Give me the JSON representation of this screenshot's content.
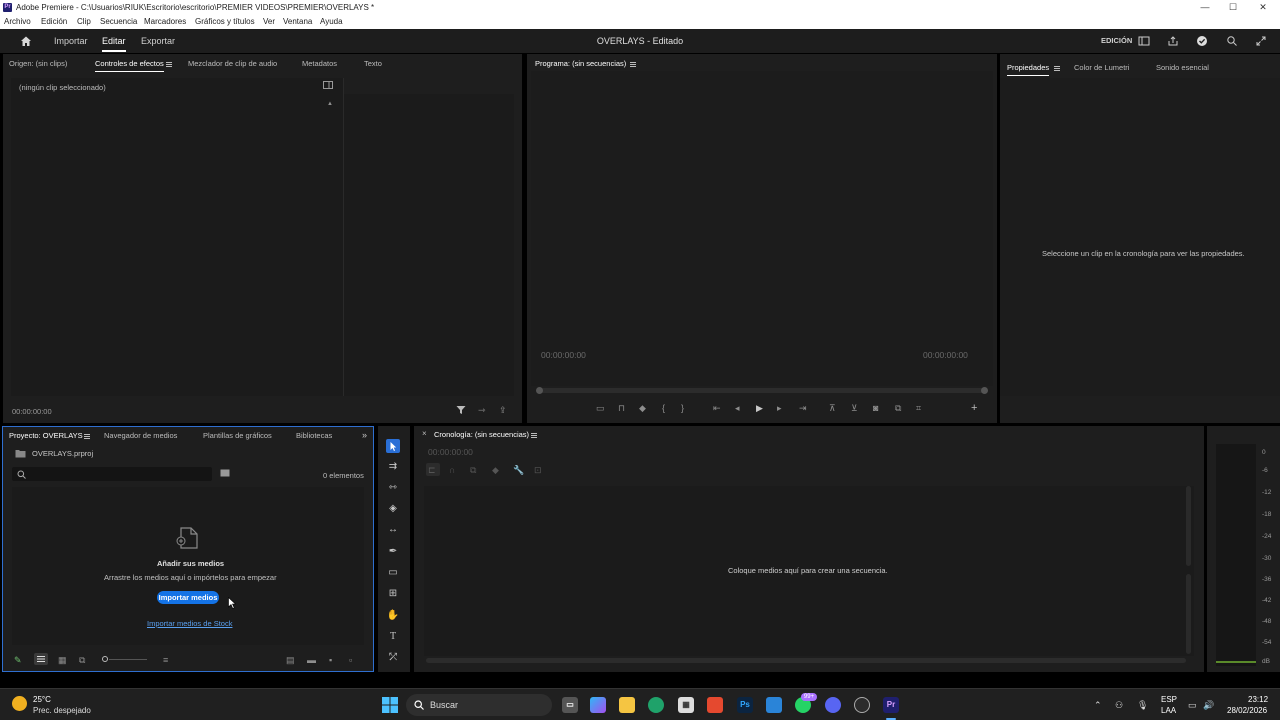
{
  "window": {
    "title": "Adobe Premiere - C:\\Usuarios\\RIUK\\Escritorio\\escritorio\\PREMIER VIDEOS\\PREMIER\\OVERLAYS *",
    "minimize": "—",
    "maximize": "☐",
    "close": "✕"
  },
  "menu": [
    "Archivo",
    "Edición",
    "Clip",
    "Secuencia",
    "Marcadores",
    "Gráficos y títulos",
    "Ver",
    "Ventana",
    "Ayuda"
  ],
  "header": {
    "nav": [
      "Importar",
      "Editar",
      "Exportar"
    ],
    "active_nav": "Editar",
    "project_title": "OVERLAYS - Editado",
    "workspace_label": "EDICIÓN"
  },
  "source_panel": {
    "tabs": [
      "Origen: (sin clips)",
      "Controles de efectos",
      "Mezclador de clip de audio",
      "Metadatos",
      "Texto"
    ],
    "active_tab": "Controles de efectos",
    "no_clip": "(ningún clip seleccionado)",
    "timecode": "00:00:00:00"
  },
  "program_panel": {
    "tab": "Programa: (sin secuencias)",
    "timecode_left": "00:00:00:00",
    "timecode_right": "00:00:00:00"
  },
  "properties_panel": {
    "tabs": [
      "Propiedades",
      "Color de Lumetri",
      "Sonido esencial"
    ],
    "active_tab": "Propiedades",
    "message": "Seleccione un clip en la cronología para ver las propiedades."
  },
  "project_panel": {
    "tabs": [
      "Proyecto: OVERLAYS",
      "Navegador de medios",
      "Plantillas de gráficos",
      "Bibliotecas"
    ],
    "active_tab": "Proyecto: OVERLAYS",
    "file_name": "OVERLAYS.prproj",
    "search_placeholder": "",
    "item_count": "0 elementos",
    "add_media_title": "Añadir sus medios",
    "add_media_desc": "Arrastre los medios aquí o impórtelos para empezar",
    "import_button": "Importar medios",
    "stock_link": "Importar medios de Stock"
  },
  "timeline_panel": {
    "tab": "Cronología: (sin secuencias)",
    "timecode": "00:00:00:00",
    "empty_message": "Coloque medios aquí para crear una secuencia."
  },
  "audio_meter": {
    "scale": [
      "0",
      "-6",
      "-12",
      "-18",
      "-24",
      "-30",
      "-36",
      "-42",
      "-48",
      "-54",
      "dB"
    ]
  },
  "taskbar": {
    "weather_temp": "25°C",
    "weather_desc": "Prec. despejado",
    "search": "Buscar",
    "lang_1": "ESP",
    "lang_2": "LAA",
    "time": "23:12",
    "date": "28/02/2026",
    "badge": "99+"
  },
  "colors": {
    "accent": "#1473e6",
    "panel_bg": "#1e1e1e",
    "app_bg": "#000000"
  }
}
